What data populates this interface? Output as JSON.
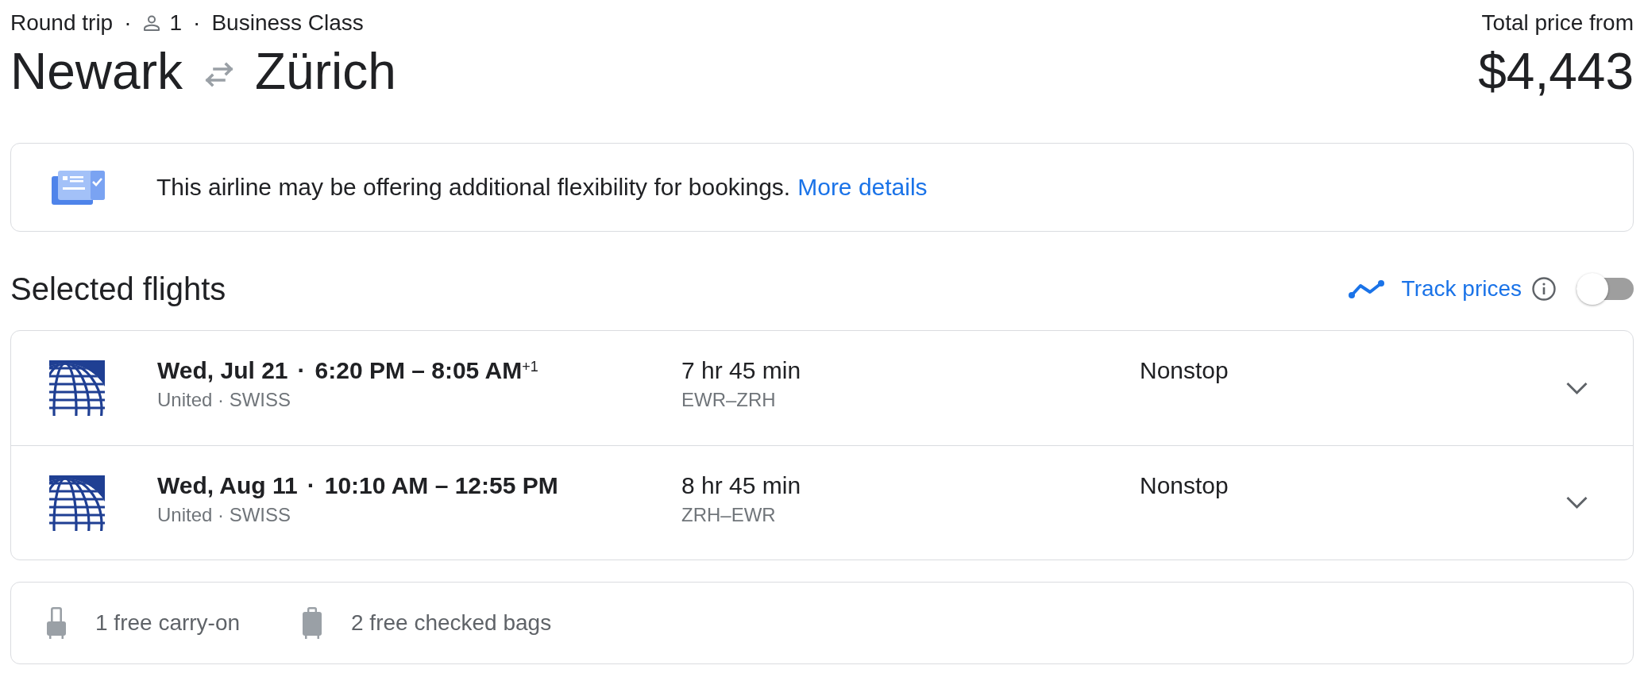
{
  "trip_summary": [
    {
      "kind": "text",
      "text": "Round trip"
    },
    {
      "kind": "separator",
      "text": "·"
    },
    {
      "kind": "passengers",
      "text": "1"
    },
    {
      "kind": "separator",
      "text": "·"
    },
    {
      "kind": "text",
      "text": "Business Class"
    }
  ],
  "route": {
    "origin": "Newark",
    "destination": "Zürich"
  },
  "price": {
    "label": "Total price from",
    "amount": "$4,443"
  },
  "notice": {
    "text": "This airline may be offering additional flexibility for bookings.",
    "link": "More details"
  },
  "selected_flights": {
    "title": "Selected flights",
    "track_prices": {
      "label": "Track prices",
      "on": false
    },
    "flights": [
      {
        "date": "Wed, Jul 21",
        "separator": "·",
        "times": "6:20 PM – 8:05 AM$^{+1}$",
        "airlines": "United · SWISS",
        "duration": "7 hr 45 min",
        "route": "EWR–ZRH",
        "stops": "Nonstop",
        "expanded": false
      },
      {
        "date": "Wed, Aug 11",
        "separator": "·",
        "times": "10:10 AM – 12:55 PM",
        "airlines": "United · SWISS",
        "duration": "8 hr 45 min",
        "route": "ZRH–EWR",
        "stops": "Nonstop",
        "expanded": false
      }
    ]
  },
  "baggage": [
    {
      "kind": "carry_on",
      "text": "1 free carry-on"
    },
    {
      "kind": "checked",
      "text": "2 free checked bags"
    }
  ]
}
